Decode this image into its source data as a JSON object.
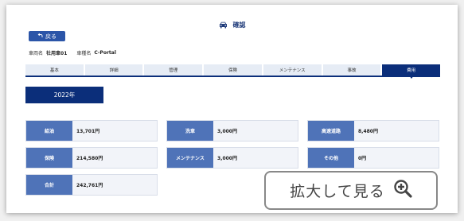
{
  "header": {
    "title": "確認"
  },
  "back": {
    "label": "戻る"
  },
  "vehicle": {
    "name_label": "車両名",
    "name_value": "社用車01",
    "type_label": "車種名",
    "type_value": "C-Portal"
  },
  "tabs": [
    {
      "label": "基本"
    },
    {
      "label": "詳細"
    },
    {
      "label": "管理"
    },
    {
      "label": "保険"
    },
    {
      "label": "メンテナンス"
    },
    {
      "label": "事故"
    },
    {
      "label": "費用",
      "active": true
    }
  ],
  "year": {
    "label": "2022年"
  },
  "costs": [
    {
      "key": "給油",
      "value": "13,701円"
    },
    {
      "key": "洗車",
      "value": "3,000円"
    },
    {
      "key": "高速道路",
      "value": "8,480円"
    },
    {
      "key": "保険",
      "value": "214,580円"
    },
    {
      "key": "メンテナンス",
      "value": "3,000円"
    },
    {
      "key": "その他",
      "value": "0円"
    },
    {
      "key": "合計",
      "value": "242,761円"
    }
  ],
  "zoom": {
    "label": "拡大して見る"
  },
  "colors": {
    "primary": "#0b2e7a",
    "cell_key": "#4f73b8",
    "button": "#2b55a8"
  }
}
